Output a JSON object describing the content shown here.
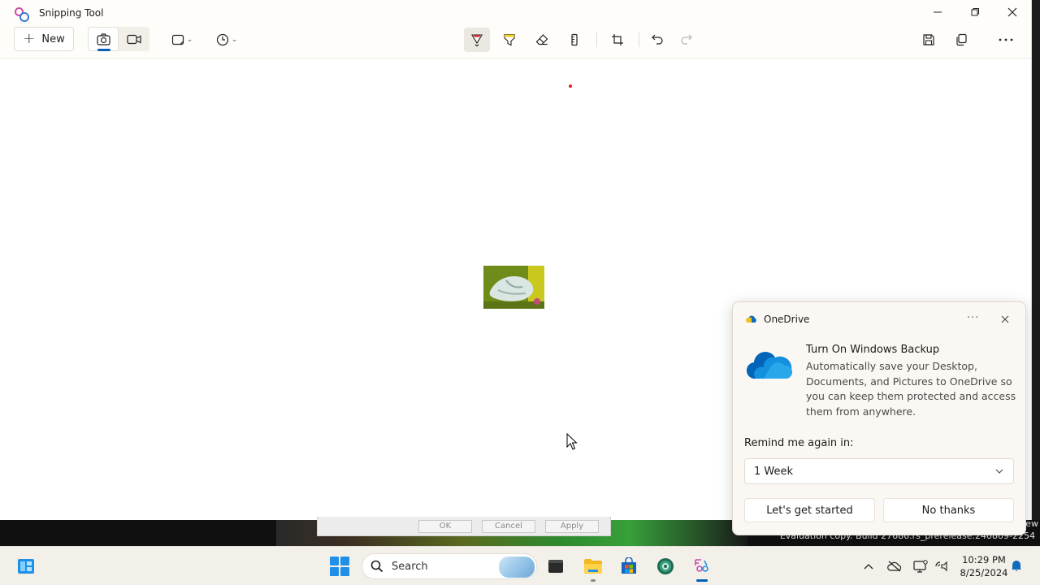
{
  "window": {
    "title": "Snipping Tool",
    "controls": [
      "minimize",
      "maximize",
      "close"
    ]
  },
  "toolbar": {
    "new_label": "New",
    "modes": [
      "camera-icon",
      "video-icon"
    ],
    "tools": [
      "rectangle-mode-icon",
      "delay-clock-icon",
      "ballpoint-pen-icon",
      "highlighter-icon",
      "eraser-icon",
      "ruler-icon",
      "crop-icon",
      "undo-icon",
      "redo-icon",
      "save-icon",
      "copy-icon",
      "more-icon"
    ],
    "accent": "#005fb8"
  },
  "background": {
    "dialog_buttons": [
      "OK",
      "Cancel",
      "Apply"
    ],
    "eval_fragment": "ew",
    "eval_text": "Evaluation copy. Build 27686.rs_prerelease.240809-2254"
  },
  "toast": {
    "app": "OneDrive",
    "more": "···",
    "title": "Turn On Windows Backup",
    "body": "Automatically save your Desktop, Documents, and Pictures to OneDrive so you can keep them protected and access them from anywhere.",
    "remind_label": "Remind me again in:",
    "remind_value": "1 Week",
    "primary_button": "Let's get started",
    "secondary_button": "No thanks"
  },
  "taskbar": {
    "search_placeholder": "Search",
    "apps": [
      "start-icon",
      "file-explorer-icon",
      "microsoft-store-icon",
      "edge-dev-icon",
      "snipping-tool-icon",
      "terminal-icon"
    ],
    "tray": [
      "chevron-up-icon",
      "onedrive-offline-icon",
      "display-icon",
      "network-volume-icon"
    ],
    "time": "10:29 PM",
    "date": "8/25/2024"
  }
}
